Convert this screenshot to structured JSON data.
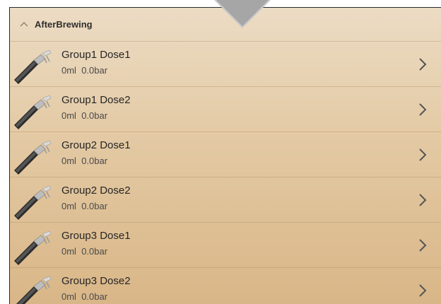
{
  "section": {
    "title": "AfterBrewing",
    "collapse_icon": "chevron-up-icon"
  },
  "items": [
    {
      "name": "Group1 Dose1",
      "volume": "0ml",
      "pressure": "0.0bar",
      "icon": "portafilter-icon"
    },
    {
      "name": "Group1 Dose2",
      "volume": "0ml",
      "pressure": "0.0bar",
      "icon": "portafilter-icon"
    },
    {
      "name": "Group2 Dose1",
      "volume": "0ml",
      "pressure": "0.0bar",
      "icon": "portafilter-icon"
    },
    {
      "name": "Group2 Dose2",
      "volume": "0ml",
      "pressure": "0.0bar",
      "icon": "portafilter-icon"
    },
    {
      "name": "Group3 Dose1",
      "volume": "0ml",
      "pressure": "0.0bar",
      "icon": "portafilter-icon"
    },
    {
      "name": "Group3 Dose2",
      "volume": "0ml",
      "pressure": "0.0bar",
      "icon": "portafilter-icon"
    }
  ],
  "colors": {
    "background_top": "#ecdcc4",
    "background_bottom": "#d9b687",
    "pointer": "#a6a6a6",
    "text": "#262626"
  }
}
